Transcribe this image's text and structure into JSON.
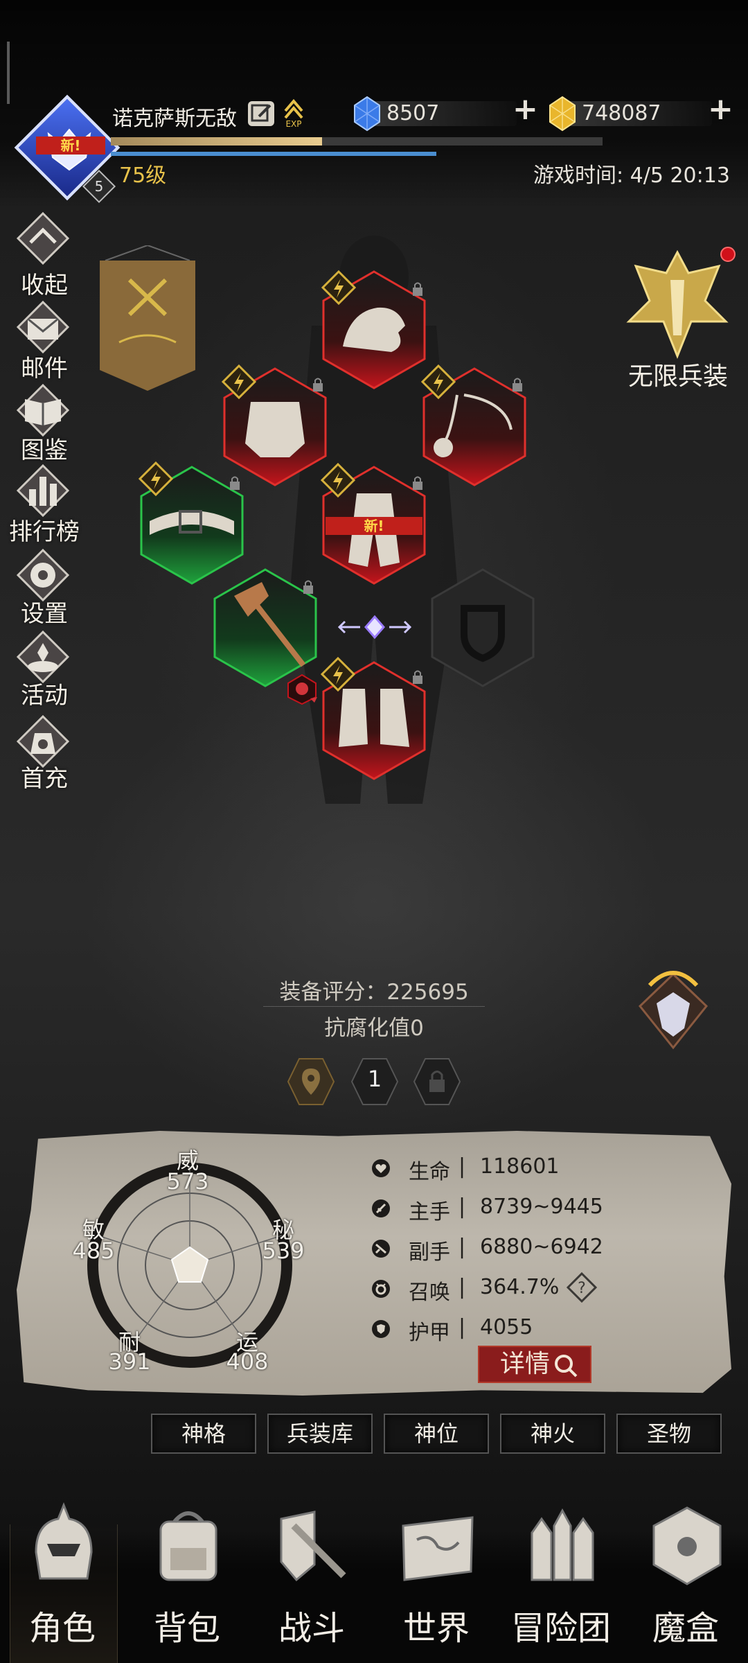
{
  "header": {
    "player_name": "诺克萨斯无敌",
    "new_badge": "新!",
    "rank_number": "5",
    "level": "75级",
    "game_time": "游戏时间: 4/5 20:13",
    "exp_label": "EXP",
    "exp_progress": 0.43,
    "diamonds": "8507",
    "gold": "748087"
  },
  "side_menu": {
    "collapse": "收起",
    "mail": "邮件",
    "codex": "图鉴",
    "leaderboard": "排行榜",
    "settings": "设置",
    "events": "活动",
    "first_recharge": "首充"
  },
  "equipment": {
    "new_badge": "新!",
    "infinite_label": "无限兵装",
    "score": "装备评分：225695",
    "corruption": "抗腐化值0",
    "slot_number": "1"
  },
  "attributes": {
    "wei_label": "威",
    "wei_value": "573",
    "mi_label": "秘",
    "mi_value": "539",
    "min_label": "敏",
    "min_value": "485",
    "nai_label": "耐",
    "nai_value": "391",
    "yun_label": "运",
    "yun_value": "408"
  },
  "stats": {
    "hp_name": "生命",
    "hp_value": "118601",
    "main_name": "主手",
    "main_value": "8739~9445",
    "off_name": "副手",
    "off_value": "6880~6942",
    "summon_name": "召唤",
    "summon_value": "364.7%",
    "armor_name": "护甲",
    "armor_value": "4055",
    "separator": "|",
    "detail_label": "详情"
  },
  "sub_tabs": [
    "神格",
    "兵装库",
    "神位",
    "神火",
    "圣物"
  ],
  "nav": [
    "角色",
    "背包",
    "战斗",
    "世界",
    "冒险团",
    "魔盒"
  ],
  "colors": {
    "accent_gold": "#e8c24a",
    "rarity_red": "#c4141c",
    "rarity_green": "#1fa23c",
    "detail_red": "#8a1c1c"
  }
}
